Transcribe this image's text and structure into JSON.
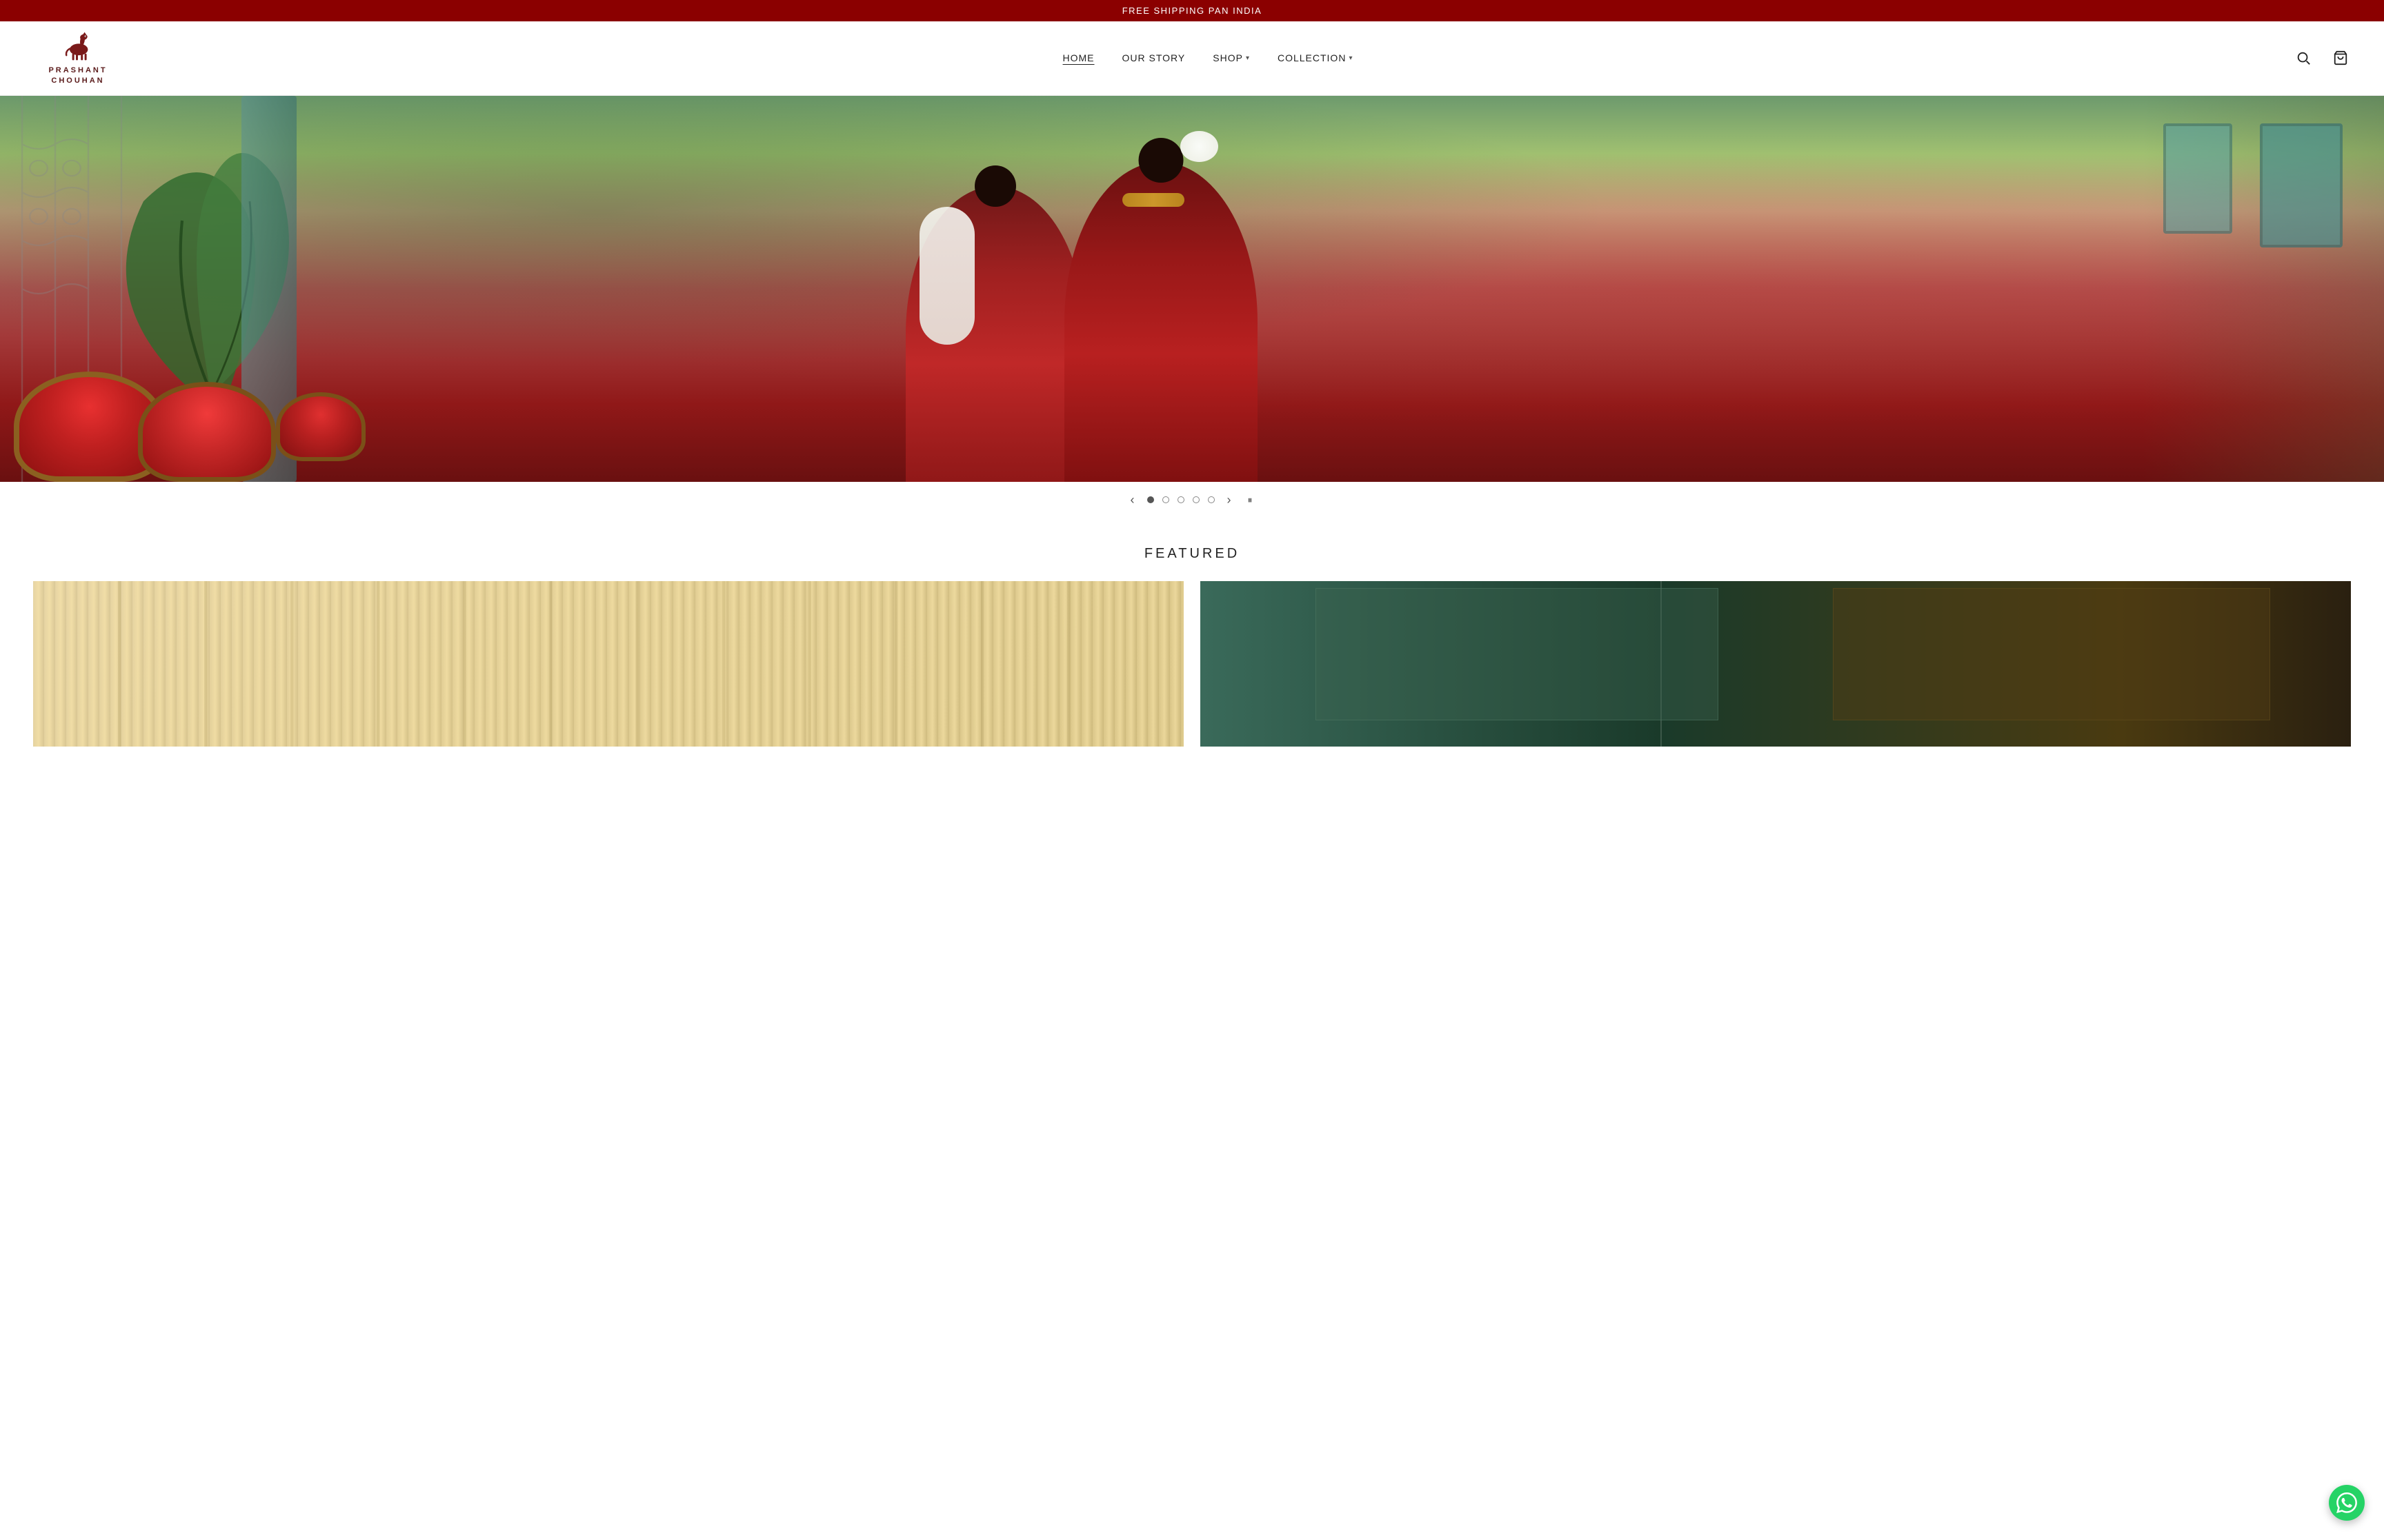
{
  "announcement": {
    "text": "FREE SHIPPING PAN INDIA"
  },
  "header": {
    "logo": {
      "brand_name_line1": "PRASHANT",
      "brand_name_line2": "CHOUHAN",
      "alt": "Prashant Chouhan Logo"
    },
    "nav": {
      "items": [
        {
          "id": "home",
          "label": "HOME",
          "active": true,
          "has_dropdown": false
        },
        {
          "id": "our-story",
          "label": "OUR STORY",
          "active": false,
          "has_dropdown": false
        },
        {
          "id": "shop",
          "label": "SHOP",
          "active": false,
          "has_dropdown": true
        },
        {
          "id": "collection",
          "label": "COLLECTION",
          "active": false,
          "has_dropdown": true
        }
      ]
    },
    "icons": {
      "search": "🔍",
      "cart": "🛍"
    }
  },
  "hero": {
    "slides": [
      {
        "index": 0,
        "active": true
      },
      {
        "index": 1,
        "active": false
      },
      {
        "index": 2,
        "active": false
      },
      {
        "index": 3,
        "active": false
      },
      {
        "index": 4,
        "active": false
      }
    ],
    "prev_label": "‹",
    "next_label": "›",
    "pause_label": "⏸"
  },
  "featured": {
    "title": "FEATURED",
    "cards": [
      {
        "id": "card-1",
        "alt": "Featured collection 1 - light curtain backdrop"
      },
      {
        "id": "card-2",
        "alt": "Featured collection 2 - outdoor setting"
      }
    ]
  },
  "whatsapp": {
    "label": "Chat on WhatsApp",
    "icon": "💬"
  },
  "colors": {
    "announcement_bg": "#8b0000",
    "brand_red": "#6b1a1a",
    "accent_green": "#25d366"
  }
}
